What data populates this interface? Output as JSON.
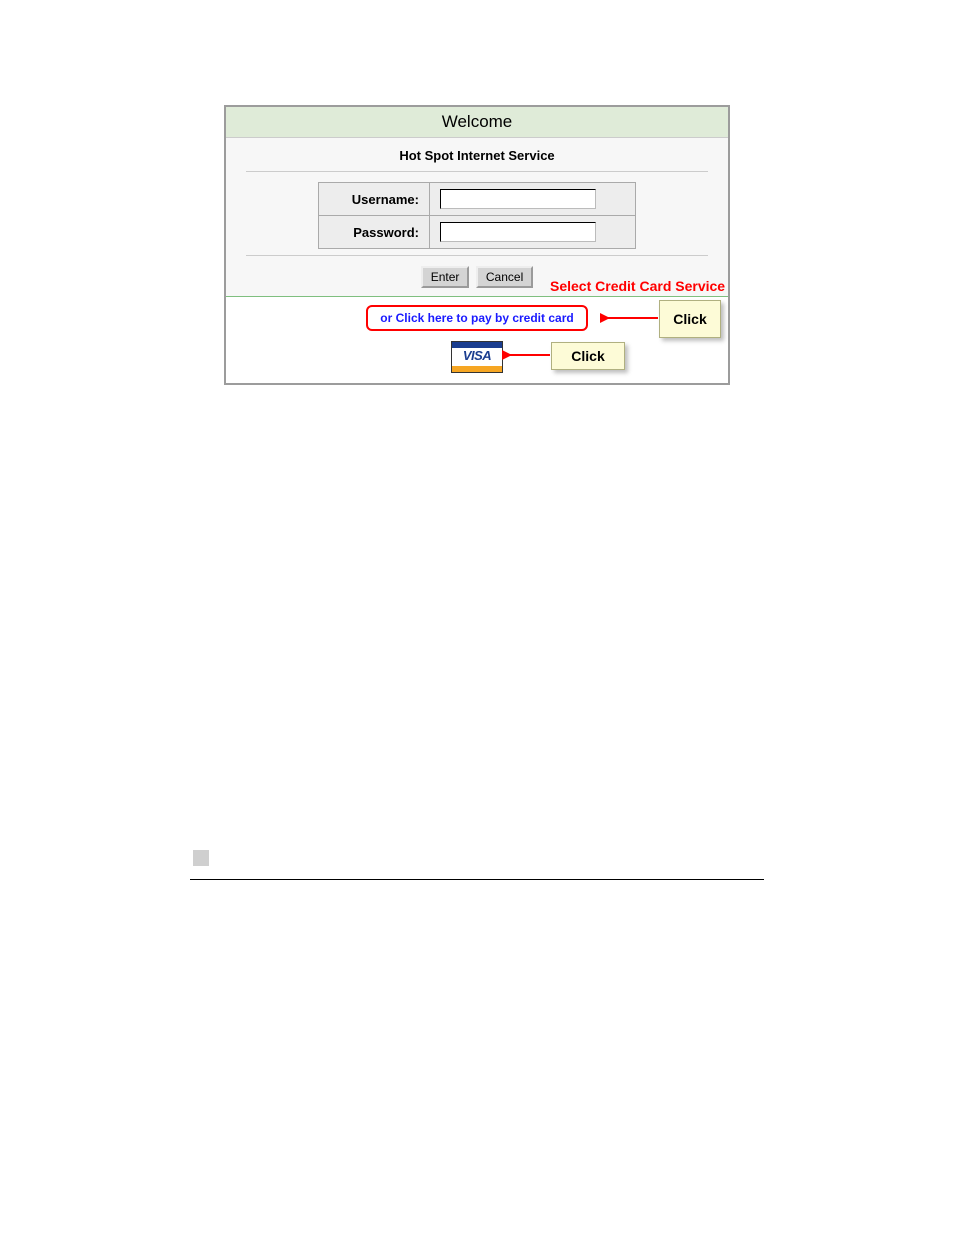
{
  "panel": {
    "title": "Welcome",
    "subtitle": "Hot Spot Internet Service",
    "username_label": "Username:",
    "password_label": "Password:",
    "username_value": "",
    "password_value": "",
    "enter_label": "Enter",
    "cancel_label": "Cancel",
    "cc_link_text": "or Click here to pay by credit card",
    "visa_text": "VISA"
  },
  "annotations": {
    "heading": "Select Credit Card Service",
    "click1": "Click",
    "click2": "Click"
  }
}
